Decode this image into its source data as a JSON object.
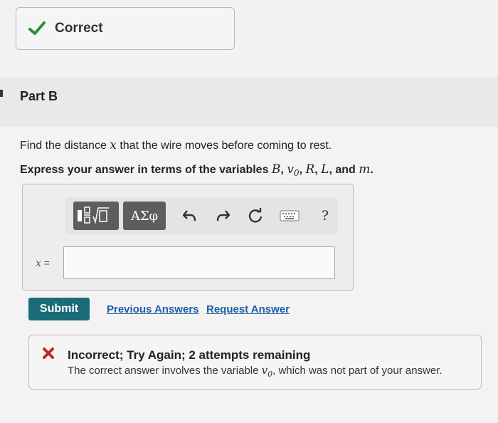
{
  "status": {
    "label": "Correct",
    "icon": "check-icon",
    "color": "#2e8b3a"
  },
  "part": {
    "title": "Part B"
  },
  "question": {
    "prefix": "Find the distance ",
    "variable": "x",
    "suffix": " that the wire moves before coming to rest."
  },
  "instruction": {
    "prefix": "Express your answer in terms of the variables ",
    "v1": "B",
    "sep1": ", ",
    "v2": "v",
    "v2_sub": "0",
    "sep2": ", ",
    "v3": "R",
    "sep3": ", ",
    "v4": "L",
    "sep4": ", and ",
    "v5": "m",
    "end": "."
  },
  "toolbar": {
    "greek_label": "ΑΣφ",
    "help_label": "?",
    "icons": [
      "templates-icon",
      "undo-icon",
      "redo-icon",
      "reset-icon",
      "keyboard-icon",
      "help-icon"
    ]
  },
  "answer": {
    "variable": "x",
    "equals": " =",
    "value": ""
  },
  "actions": {
    "submit_label": "Submit",
    "previous_answers_label": "Previous Answers",
    "request_answer_label": "Request Answer"
  },
  "feedback": {
    "title": "Incorrect; Try Again; 2 attempts remaining",
    "text_prefix": "The correct answer involves the variable ",
    "variable": "v",
    "variable_sub": "0",
    "text_suffix": ", which was not part of your answer.",
    "icon": "x-icon",
    "color": "#c0282d"
  },
  "colors": {
    "submit": "#1b6b78",
    "link": "#1d5fa6",
    "toolbar_button": "#5d5d5d"
  }
}
